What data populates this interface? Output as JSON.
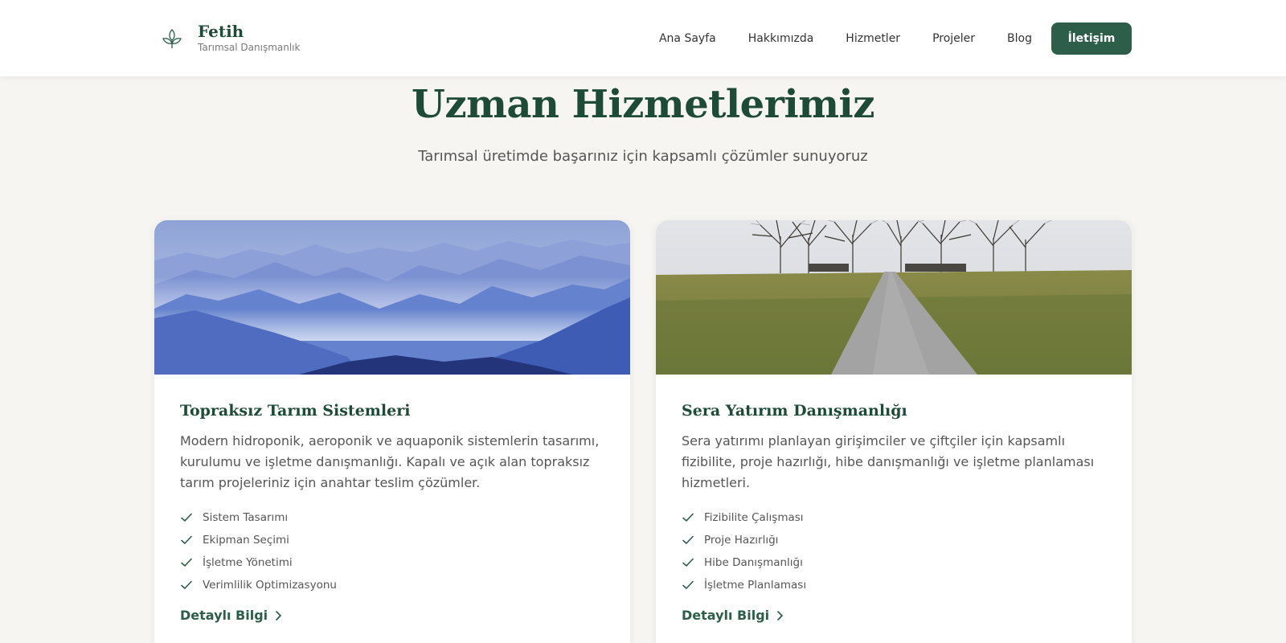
{
  "brand": {
    "name": "Fetih",
    "tagline": "Tarımsal Danışmanlık"
  },
  "nav": {
    "items": [
      "Ana Sayfa",
      "Hakkımızda",
      "Hizmetler",
      "Projeler",
      "Blog"
    ],
    "cta": "İletişim"
  },
  "hero": {
    "title": "Uzman Hizmetlerimiz",
    "subtitle": "Tarımsal üretimde başarınız için kapsamlı çözümler sunuyoruz"
  },
  "cards": [
    {
      "title": "Topraksız Tarım Sistemleri",
      "description": "Modern hidroponik, aeroponik ve aquaponik sistemlerin tasarımı, kurulumu ve işletme danışmanlığı. Kapalı ve açık alan topraksız tarım projeleriniz için anahtar teslim çözümler.",
      "features": [
        "Sistem Tasarımı",
        "Ekipman Seçimi",
        "İşletme Yönetimi",
        "Verimlilik Optimizasyonu"
      ],
      "link": "Detaylı Bilgi"
    },
    {
      "title": "Sera Yatırım Danışmanlığı",
      "description": "Sera yatırımı planlayan girişimciler ve çiftçiler için kapsamlı fizibilite, proje hazırlığı, hibe danışmanlığı ve işletme planlaması hizmetleri.",
      "features": [
        "Fizibilite Çalışması",
        "Proje Hazırlığı",
        "Hibe Danışmanlığı",
        "İşletme Planlaması"
      ],
      "link": "Detaylı Bilgi"
    }
  ],
  "colors": {
    "primary": "#2c5e4a",
    "heading": "#1e4a38",
    "background": "#f7f5f1"
  }
}
